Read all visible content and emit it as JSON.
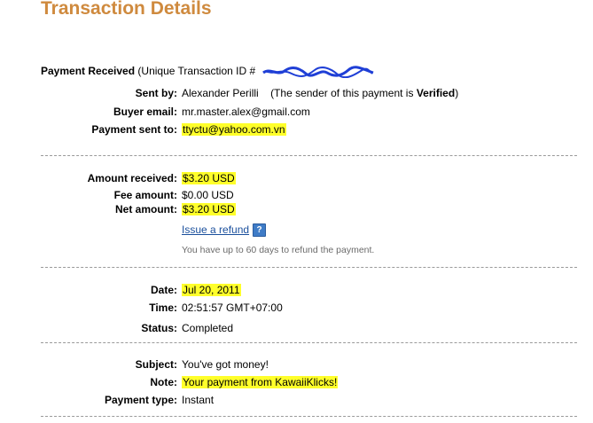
{
  "page": {
    "title": "Transaction Details"
  },
  "payment": {
    "header_label": "Payment Received",
    "header_suffix": "(Unique Transaction ID #",
    "sent_by": {
      "label": "Sent by:",
      "name": "Alexander Perilli",
      "note_prefix": "(The sender of this payment is",
      "note_status": "Verified",
      "note_suffix": ")"
    },
    "buyer_email": {
      "label": "Buyer email:",
      "value": "mr.master.alex@gmail.com"
    },
    "sent_to": {
      "label": "Payment sent to:",
      "value": "ttyctu@yahoo.com.vn"
    }
  },
  "amounts": {
    "received": {
      "label": "Amount received:",
      "value": "$3.20 USD"
    },
    "fee": {
      "label": "Fee amount:",
      "value": "$0.00 USD"
    },
    "net": {
      "label": "Net amount:",
      "value": "$3.20 USD"
    },
    "refund_link": "Issue a refund",
    "help_icon": "?",
    "refund_note": "You have up to 60 days to refund the payment."
  },
  "timing": {
    "date": {
      "label": "Date:",
      "value": "Jul 20, 2011"
    },
    "time": {
      "label": "Time:",
      "value": "02:51:57 GMT+07:00"
    },
    "status": {
      "label": "Status:",
      "value": "Completed"
    }
  },
  "message": {
    "subject": {
      "label": "Subject:",
      "value": "You've got money!"
    },
    "note": {
      "label": "Note:",
      "value": "Your payment from KawaiiKlicks!"
    },
    "payment_type": {
      "label": "Payment type:",
      "value": "Instant"
    }
  },
  "colors": {
    "title": "#cf8a3e",
    "highlight": "#ffff2a",
    "link": "#1a4f9c",
    "redaction": "#1f3fd6"
  },
  "icons": {
    "redaction": "scribble-redaction",
    "help": "help-question-icon"
  }
}
